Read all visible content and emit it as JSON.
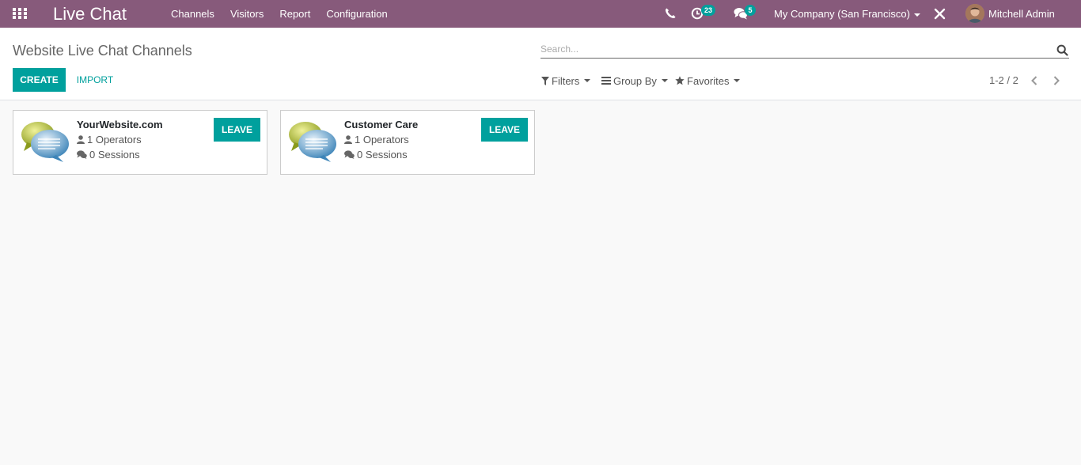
{
  "navbar": {
    "app_title": "Live Chat",
    "menu": [
      "Channels",
      "Visitors",
      "Report",
      "Configuration"
    ],
    "activity_count": "23",
    "messages_count": "5",
    "company": "My Company (San Francisco)",
    "user_name": "Mitchell Admin"
  },
  "control_panel": {
    "title": "Website Live Chat Channels",
    "search_placeholder": "Search...",
    "create_label": "CREATE",
    "import_label": "IMPORT",
    "filters_label": "Filters",
    "groupby_label": "Group By",
    "favorites_label": "Favorites",
    "pager": "1-2 / 2"
  },
  "channels": [
    {
      "name": "YourWebsite.com",
      "operators": "1 Operators",
      "sessions": "0 Sessions",
      "action": "LEAVE"
    },
    {
      "name": "Customer Care",
      "operators": "1 Operators",
      "sessions": "0 Sessions",
      "action": "LEAVE"
    }
  ],
  "colors": {
    "navbar": "#875a7b",
    "primary": "#00a09d"
  }
}
